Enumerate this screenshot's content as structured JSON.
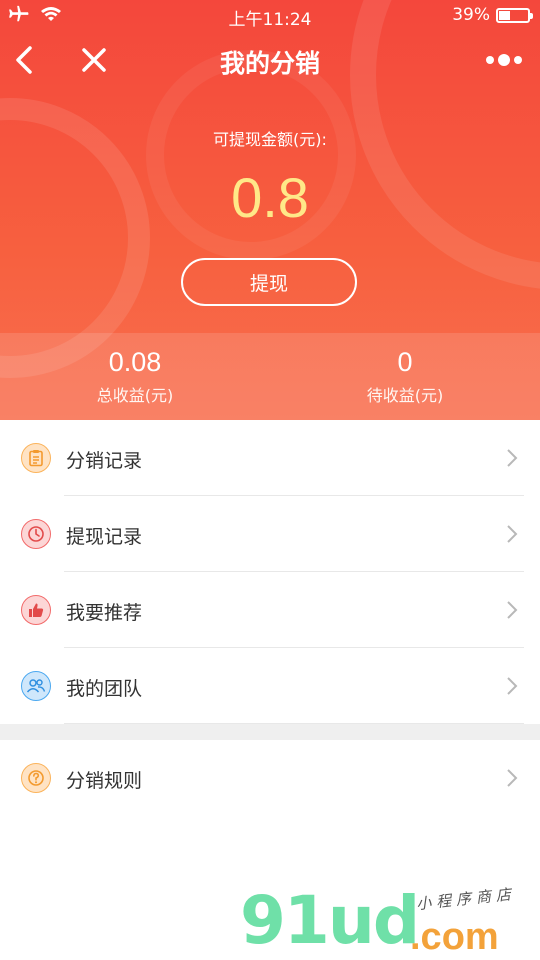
{
  "status_bar": {
    "time": "上午11:24",
    "battery": "39%",
    "left_icons": [
      "airplane-icon",
      "wifi-icon"
    ]
  },
  "nav": {
    "title": "我的分销",
    "back_icon": "chevron-left-icon",
    "close_icon": "close-icon",
    "more_icon": "more-dots-icon"
  },
  "balance": {
    "label": "可提现金额(元):",
    "amount": "0.8",
    "withdraw_label": "提现"
  },
  "stats": [
    {
      "value": "0.08",
      "label": "总收益(元)"
    },
    {
      "value": "0",
      "label": "待收益(元)"
    }
  ],
  "menu": [
    {
      "label": "分销记录",
      "icon": "clipboard-icon",
      "color": "#fbb35a"
    },
    {
      "label": "提现记录",
      "icon": "clock-icon",
      "color": "#f26a6a"
    },
    {
      "label": "我要推荐",
      "icon": "thumbs-up-icon",
      "color": "#f26a6a"
    },
    {
      "label": "我的团队",
      "icon": "team-icon",
      "color": "#4aa8f0"
    }
  ],
  "menu2": [
    {
      "label": "分销规则",
      "icon": "question-icon",
      "color": "#fbb35a"
    }
  ],
  "watermark": {
    "logo": "91ud",
    "domain": ".com",
    "tagline": "小程序商店"
  },
  "colors": {
    "header_top": "#f4473c",
    "header_bottom": "#f86f4f",
    "amount": "#ffe888"
  }
}
